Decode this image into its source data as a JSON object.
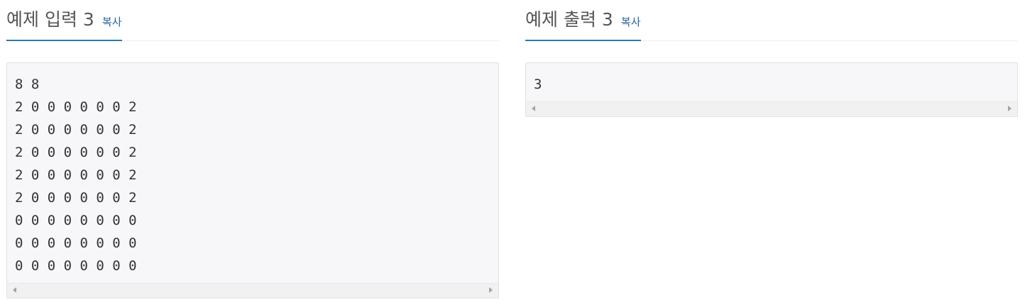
{
  "input_section": {
    "title": "예제 입력 3",
    "copy_label": "복사",
    "content": "8 8\n2 0 0 0 0 0 0 2\n2 0 0 0 0 0 0 2\n2 0 0 0 0 0 0 2\n2 0 0 0 0 0 0 2\n2 0 0 0 0 0 0 2\n0 0 0 0 0 0 0 0\n0 0 0 0 0 0 0 0\n0 0 0 0 0 0 0 0"
  },
  "output_section": {
    "title": "예제 출력 3",
    "copy_label": "복사",
    "content": "3"
  },
  "colors": {
    "heading_underline": "#2a7ab0",
    "copy_link": "#2a6496",
    "sample_background": "#f7f7f9"
  },
  "icons": {
    "scroll_left": "scroll-left-arrow-icon",
    "scroll_right": "scroll-right-arrow-icon"
  }
}
